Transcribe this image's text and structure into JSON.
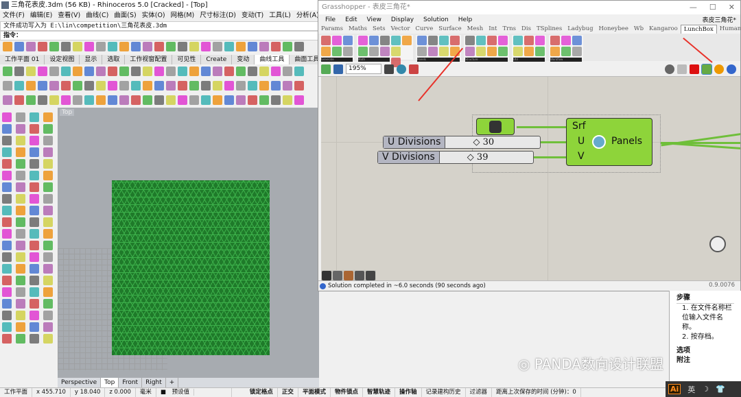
{
  "rhino": {
    "title": "三角花表皮.3dm (56 KB) - Rhinoceros 5.0 [Cracked] - [Top]",
    "menu": [
      "文件(F)",
      "编辑(E)",
      "查看(V)",
      "曲线(C)",
      "曲面(S)",
      "实体(O)",
      "网格(M)",
      "尺寸标注(D)",
      "变动(T)",
      "工具(L)",
      "分析(A)",
      "渲染(R)",
      "面"
    ],
    "history": "文件成功写入为 E:\\lin\\competition\\三角花表皮.3dm",
    "command_prompt": "指令：",
    "tabs": [
      "工作平面 01",
      "设定视图",
      "显示",
      "选取",
      "工作视窗配置",
      "可见性",
      "Create",
      "变动",
      "曲线工具",
      "曲面工具",
      "实"
    ],
    "active_tab": "曲线工具",
    "viewport_label": "Top",
    "viewport_tabs": [
      "Perspective",
      "Top",
      "Front",
      "Right",
      "+"
    ],
    "status": {
      "cplane": "工作平面",
      "x": "x 455.710",
      "y": "y 18.040",
      "z": "z 0.000",
      "unit": "毫米",
      "layer": "预设值",
      "toggles": [
        "锁定格点",
        "正交",
        "平面模式",
        "物件锁点",
        "智慧轨迹",
        "操作轴"
      ],
      "history": "记录建构历史",
      "filter": "过滤器",
      "save_info": "距离上次保存的时间 (分钟)：0"
    },
    "surface_color": "#1f7a2a"
  },
  "grasshopper": {
    "title": "Grasshopper - 表皮三角花*",
    "window_controls": [
      "—",
      "☐",
      "✕"
    ],
    "menu": [
      "File",
      "Edit",
      "View",
      "Display",
      "Solution",
      "Help"
    ],
    "document": "表皮三角花*",
    "tabs": [
      "Params",
      "Maths",
      "Sets",
      "Vector",
      "Curve",
      "Surface",
      "Mesh",
      "Int",
      "Trns",
      "Dis",
      "TSplines",
      "Ladybug",
      "Honeybee",
      "Wb",
      "Kangaroo",
      "LunchBox",
      "Human",
      "Extra"
    ],
    "active_tab": "LunchBox",
    "groups": [
      "Generate",
      "Math",
      "Panels",
      "Structure",
      "Util",
      "Workflow"
    ],
    "zoom": "195%",
    "nodes": {
      "u_slider": {
        "label": "U Divisions",
        "value": "◇ 30"
      },
      "v_slider": {
        "label": "V Divisions",
        "value": "◇ 39"
      },
      "panels": {
        "inputs": [
          "Srf",
          "U",
          "V"
        ],
        "name": "Panels"
      }
    },
    "status": "Solution completed in ~6.0 seconds (90 seconds ago)",
    "version": "0.9.0076",
    "node_color": "#8ed43a"
  },
  "help": {
    "heading": "步骤",
    "steps": [
      "在文件名称栏位输入文件名称。",
      "按存档。"
    ],
    "more": [
      "选项",
      "附注"
    ]
  },
  "watermark": "PANDA数向设计联盟",
  "taskbar": {
    "app": "Ai",
    "ime": "英"
  },
  "accent": "#e8322a"
}
